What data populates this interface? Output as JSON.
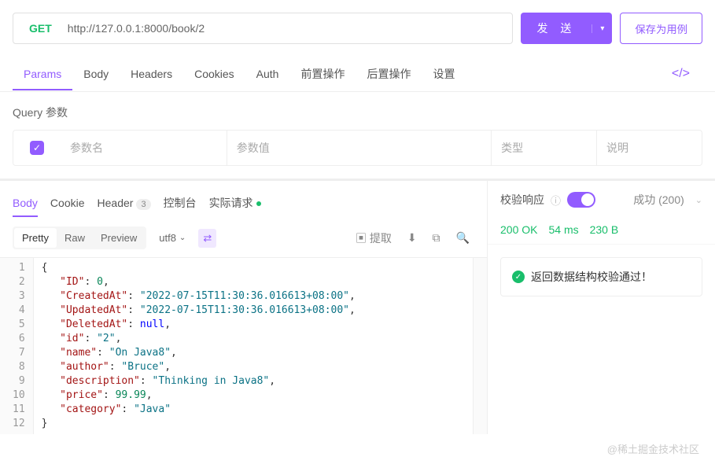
{
  "request": {
    "method": "GET",
    "url": "http://127.0.0.1:8000/book/2",
    "send_label": "发 送",
    "save_label": "保存为用例"
  },
  "config_tabs": {
    "items": [
      "Params",
      "Body",
      "Headers",
      "Cookies",
      "Auth",
      "前置操作",
      "后置操作",
      "设置"
    ],
    "active": "Params"
  },
  "params": {
    "title": "Query 参数",
    "headers": {
      "name": "参数名",
      "value": "参数值",
      "type": "类型",
      "desc": "说明"
    }
  },
  "response_tabs": {
    "body": "Body",
    "cookie": "Cookie",
    "header": "Header",
    "header_count": "3",
    "console": "控制台",
    "actual": "实际请求"
  },
  "view_modes": {
    "pretty": "Pretty",
    "raw": "Raw",
    "preview": "Preview"
  },
  "encoding": "utf8",
  "extract_label": "提取",
  "code_lines": [
    {
      "n": "1",
      "html": "<span class='j-punc'>{</span>"
    },
    {
      "n": "2",
      "html": "   <span class='j-key'>\"ID\"</span><span class='j-punc'>: </span><span class='j-num'>0</span><span class='j-punc'>,</span>"
    },
    {
      "n": "3",
      "html": "   <span class='j-key'>\"CreatedAt\"</span><span class='j-punc'>: </span><span class='j-str'>\"2022-07-15T11:30:36.016613+08:00\"</span><span class='j-punc'>,</span>"
    },
    {
      "n": "4",
      "html": "   <span class='j-key'>\"UpdatedAt\"</span><span class='j-punc'>: </span><span class='j-str'>\"2022-07-15T11:30:36.016613+08:00\"</span><span class='j-punc'>,</span>"
    },
    {
      "n": "5",
      "html": "   <span class='j-key'>\"DeletedAt\"</span><span class='j-punc'>: </span><span class='j-null'>null</span><span class='j-punc'>,</span>"
    },
    {
      "n": "6",
      "html": "   <span class='j-key'>\"id\"</span><span class='j-punc'>: </span><span class='j-str'>\"2\"</span><span class='j-punc'>,</span>"
    },
    {
      "n": "7",
      "html": "   <span class='j-key'>\"name\"</span><span class='j-punc'>: </span><span class='j-str'>\"On Java8\"</span><span class='j-punc'>,</span>"
    },
    {
      "n": "8",
      "html": "   <span class='j-key'>\"author\"</span><span class='j-punc'>: </span><span class='j-str'>\"Bruce\"</span><span class='j-punc'>,</span>"
    },
    {
      "n": "9",
      "html": "   <span class='j-key'>\"description\"</span><span class='j-punc'>: </span><span class='j-str'>\"Thinking in Java8\"</span><span class='j-punc'>,</span>"
    },
    {
      "n": "10",
      "html": "   <span class='j-key'>\"price\"</span><span class='j-punc'>: </span><span class='j-num'>99.99</span><span class='j-punc'>,</span>"
    },
    {
      "n": "11",
      "html": "   <span class='j-key'>\"category\"</span><span class='j-punc'>: </span><span class='j-str'>\"Java\"</span>"
    },
    {
      "n": "12",
      "html": "<span class='j-punc'>}</span>"
    }
  ],
  "right": {
    "title": "校验响应",
    "status_label": "成功 (200)",
    "status_ok": "200 OK",
    "time": "54 ms",
    "size": "230 B",
    "validation_msg": "返回数据结构校验通过！"
  },
  "watermark": "@稀土掘金技术社区"
}
